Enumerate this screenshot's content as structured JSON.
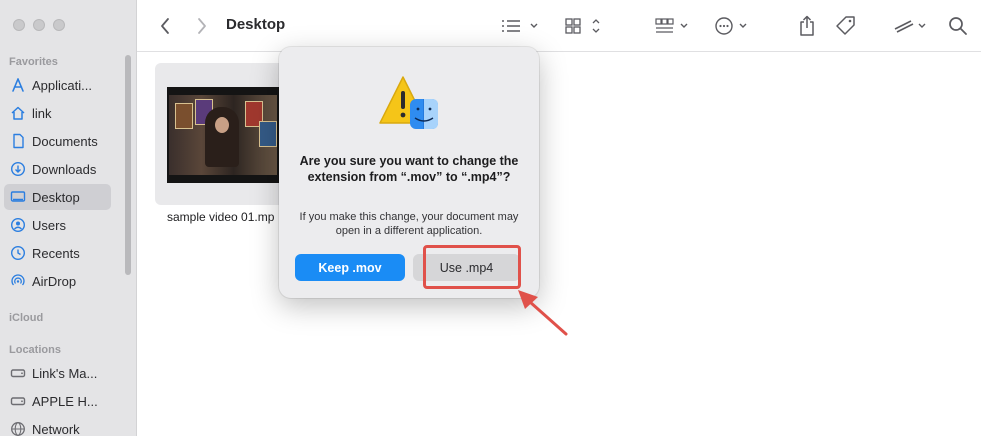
{
  "window": {
    "title": "Desktop"
  },
  "sidebar": {
    "sections": {
      "favorites": "Favorites",
      "icloud": "iCloud",
      "locations": "Locations"
    },
    "favorites": [
      {
        "label": "Applicati...",
        "icon": "applications-icon"
      },
      {
        "label": "link",
        "icon": "home-icon"
      },
      {
        "label": "Documents",
        "icon": "document-icon"
      },
      {
        "label": "Downloads",
        "icon": "download-icon"
      },
      {
        "label": "Desktop",
        "icon": "desktop-icon",
        "selected": true
      },
      {
        "label": "Users",
        "icon": "user-icon"
      },
      {
        "label": "Recents",
        "icon": "clock-icon"
      },
      {
        "label": "AirDrop",
        "icon": "airdrop-icon"
      }
    ],
    "locations": [
      {
        "label": "Link's Ma...",
        "icon": "drive-icon"
      },
      {
        "label": "APPLE H...",
        "icon": "drive-icon"
      },
      {
        "label": "Network",
        "icon": "globe-icon"
      }
    ]
  },
  "toolbar": {
    "icons": [
      "back-icon",
      "forward-icon",
      "list-view-icon",
      "grid-view-icon",
      "group-icon",
      "more-icon",
      "share-icon",
      "tag-icon",
      "edit-icon",
      "search-icon"
    ]
  },
  "files": [
    {
      "name": "sample video 01.mp"
    }
  ],
  "dialog": {
    "icon": "warning-finder-icon",
    "title": "Are you sure you want to change the extension from “.mov” to “.mp4”?",
    "message": "If you make this change, your document may open in a different application.",
    "primary_button": "Keep .mov",
    "secondary_button": "Use .mp4"
  },
  "colors": {
    "accent": "#1a8cf5",
    "annotation": "#e0514a",
    "warning": "#f5c518"
  }
}
